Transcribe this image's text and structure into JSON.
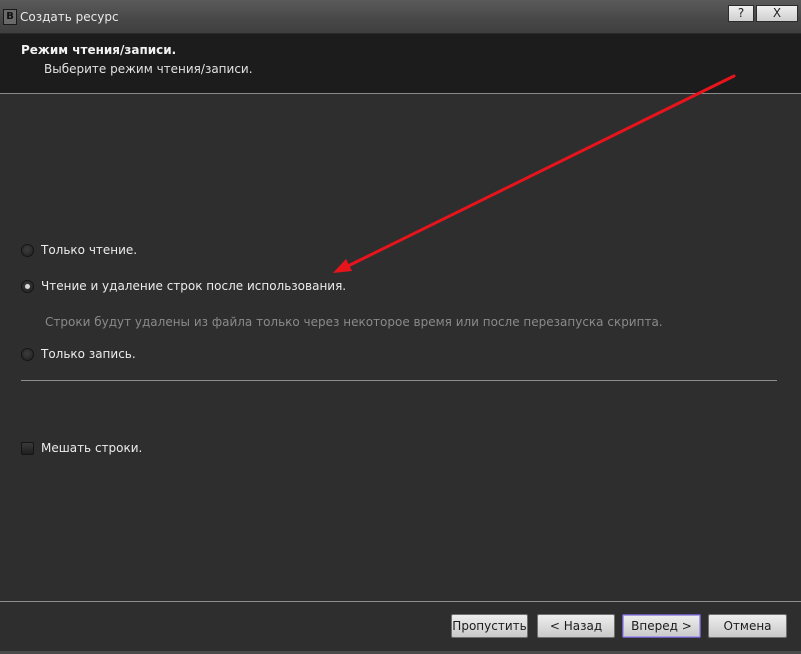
{
  "window": {
    "title": "Создать ресурс",
    "help_label": "?",
    "close_label": "X"
  },
  "header": {
    "title": "Режим чтения/записи.",
    "subtitle": "Выберите режим чтения/записи."
  },
  "options": {
    "read_only": {
      "label": "Только чтение.",
      "checked": false
    },
    "read_delete": {
      "label": "Чтение и удаление строк после использования.",
      "checked": true
    },
    "read_delete_note": "Строки будут удалены из файла только через некоторое время или после перезапуска скрипта.",
    "write_only": {
      "label": "Только запись.",
      "checked": false
    },
    "shuffle": {
      "label": "Мешать строки.",
      "checked": false
    }
  },
  "buttons": {
    "skip": "Пропустить",
    "back": "< Назад",
    "next": "Вперед >",
    "cancel": "Отмена"
  },
  "colors": {
    "annotation_arrow": "#e8141c",
    "background": "#2e2e2e",
    "header_background": "#1c1c1c",
    "primary_button_border": "#6a5bb5"
  }
}
